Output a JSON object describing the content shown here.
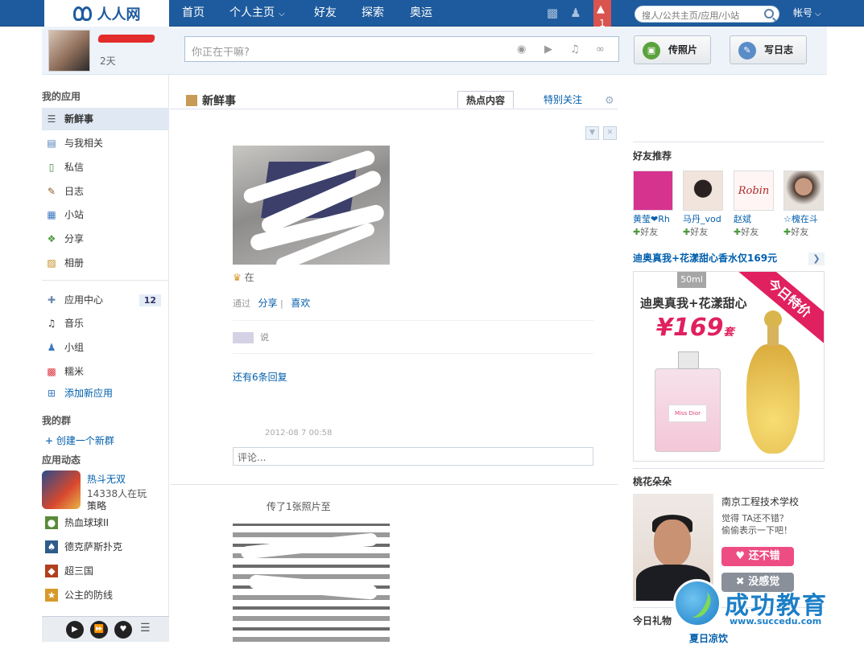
{
  "header": {
    "logo_text": "人人网",
    "nav": [
      "首页",
      "个人主页",
      "好友",
      "探索",
      "奥运"
    ],
    "notification_count": "1",
    "search_placeholder": "搜人/公共主页/应用/小站",
    "account_label": "帐号"
  },
  "publisher": {
    "days_label": "2天",
    "status_placeholder": "你正在干嘛?",
    "upload_photo_label": "传照片",
    "write_blog_label": "写日志"
  },
  "sidebar": {
    "my_apps_title": "我的应用",
    "apps": [
      "新鲜事",
      "与我相关",
      "私信",
      "日志",
      "小站",
      "分享",
      "相册"
    ],
    "app_center_label": "应用中心",
    "app_center_badge": "12",
    "apps2": [
      "音乐",
      "小组",
      "糯米"
    ],
    "add_app_label": "添加新应用",
    "my_groups_title": "我的群",
    "create_group_label": "创建一个新群",
    "app_feed_title": "应用动态",
    "featured_game": {
      "name": "热斗无双",
      "players": "14338人在玩",
      "genre": "策略"
    },
    "games": [
      "热血球球II",
      "德克萨斯扑克",
      "超三国",
      "公主的防线"
    ]
  },
  "feed": {
    "title": "新鲜事",
    "tabs": [
      "热点内容",
      "特别关注"
    ],
    "post_meta": "在",
    "action_via": "通过",
    "action_share": "分享",
    "action_like": "喜欢",
    "reply_snippet": "说",
    "more_replies": "还有6条回复",
    "timestamp": "2012-08   7 00:58",
    "comment_placeholder": "评论...",
    "post2_text": "传了1张照片至"
  },
  "right": {
    "friend_rec_title": "好友推荐",
    "friends": [
      {
        "name": "黄莹❤Rh",
        "add": "好友",
        "color": "#d6338f"
      },
      {
        "name": "马丹_vod",
        "add": "好友",
        "color": "#f1e4dc"
      },
      {
        "name": "赵斌",
        "add": "好友",
        "color": "#fff5f5"
      },
      {
        "name": "☆槐在斗",
        "add": "好友",
        "color": "#7a6a5d"
      }
    ],
    "ad_title": "迪奥真我+花漾甜心香水仅169元",
    "ad_size": "50ml",
    "ad_ribbon": "今日特价",
    "ad_line": "迪奥真我+花漾甜心",
    "ad_price": "¥169",
    "ad_unit": "套",
    "ad_label_small": "Miss Dior",
    "peach_title": "桃花朵朵",
    "peach_school": "南京工程技术学校",
    "peach_q1": "觉得 TA还不错？",
    "peach_q2": "偷偷表示一下吧！",
    "like_label": "还不错",
    "dislike_label": "没感觉",
    "gift_title": "今日礼物",
    "gift_name": "夏日凉饮"
  },
  "watermark": {
    "name": "成功教育",
    "url": "www.succedu.com"
  }
}
